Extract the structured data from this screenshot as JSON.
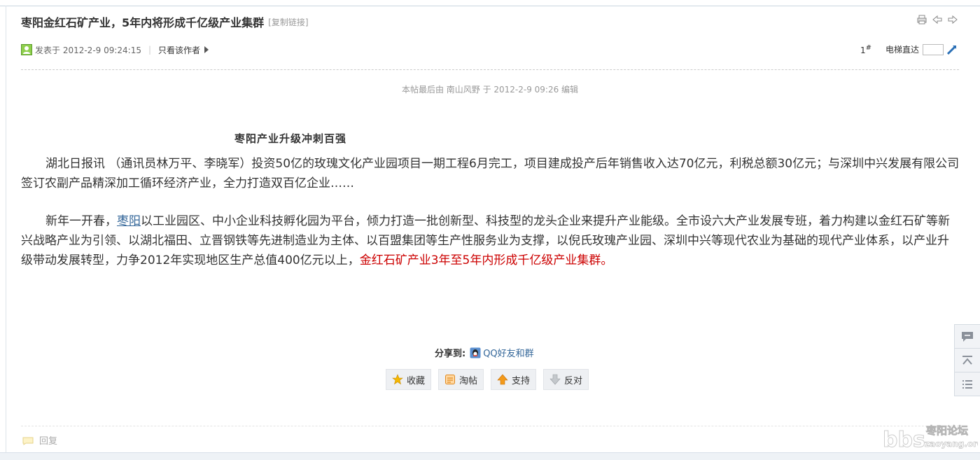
{
  "post": {
    "title": "枣阳金红石矿产业，5年内将形成千亿级产业集群",
    "copy_link": "[复制链接]",
    "posted_at": "发表于 2012-2-9 09:24:15",
    "separator": "|",
    "only_author": "只看该作者",
    "floor": "1",
    "floor_mark": "#",
    "jump_label": "电梯直达",
    "edit_note": "本帖最后由 南山风野 于 2012-2-9 09:26 编辑"
  },
  "content": {
    "subheading": "枣阳产业升级冲刺百强",
    "para1": "湖北日报讯 （通讯员林万平、李晓军）投资50亿的玫瑰文化产业园项目一期工程6月完工，项目建成投产后年销售收入达70亿元，利税总额30亿元；与深圳中兴发展有限公司签订农副产品精深加工循环经济产业，全力打造双百亿企业……",
    "para2_before": "新年一开春，",
    "para2_link": "枣阳",
    "para2_main": "以工业园区、中小企业科技孵化园为平台，倾力打造一批创新型、科技型的龙头企业来提升产业能级。全市设六大产业发展专班，着力构建以金红石矿等新兴战略产业为引领、以湖北福田、立晋钢铁等先进制造业为主体、以百盟集团等生产性服务业为支撑，以倪氏玫瑰产业园、深圳中兴等现代农业为基础的现代产业体系，以产业升级带动发展转型，力争2012年实现地区生产总值400亿元以上，",
    "para2_highlight": "金红石矿产业3年至5年内形成千亿级产业集群。"
  },
  "share": {
    "label": "分享到:",
    "qq": "QQ好友和群"
  },
  "actions": {
    "favorite": "收藏",
    "tao": "淘帖",
    "support": "支持",
    "oppose": "反对"
  },
  "reply": {
    "label": "回复"
  },
  "colors": {
    "highlight_red": "#cc0000",
    "link_blue": "#336699"
  }
}
